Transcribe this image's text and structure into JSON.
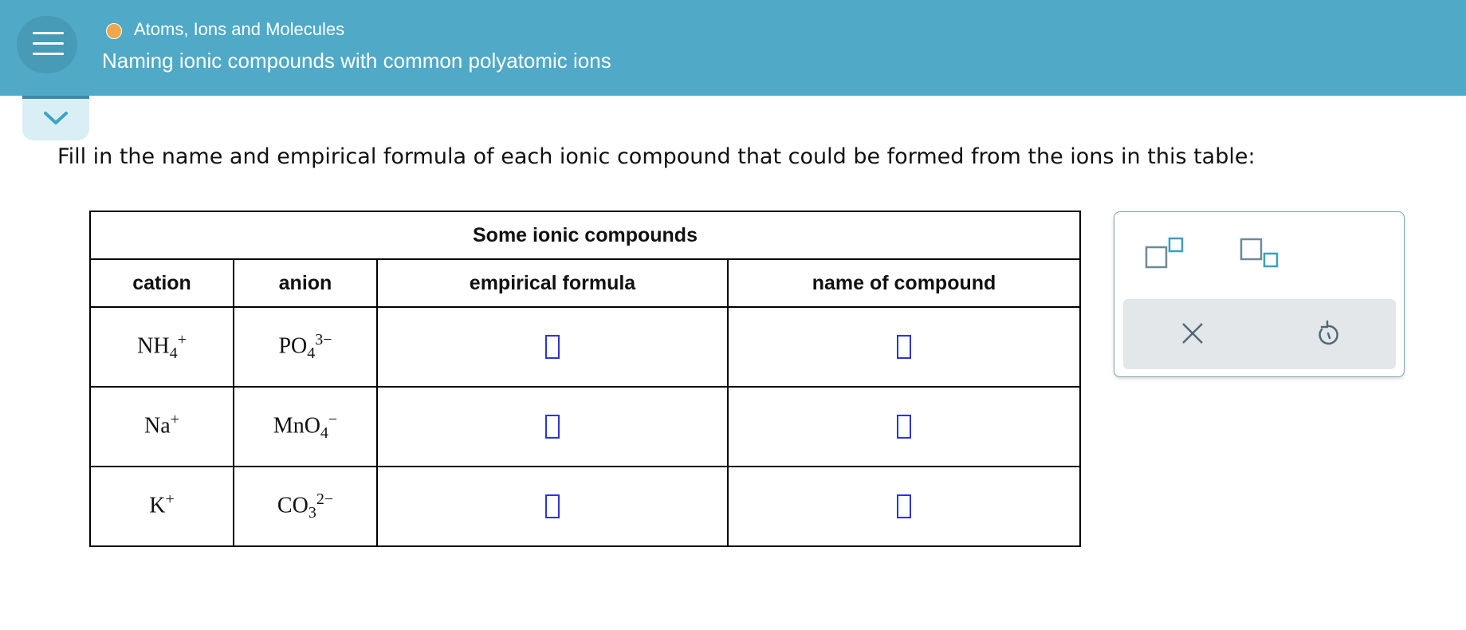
{
  "header": {
    "topic": "Atoms, Ions and Molecules",
    "lesson": "Naming ionic compounds with common polyatomic ions",
    "status_color": "#f0a64b",
    "icons": [
      "menu-icon",
      "chevron-down-icon"
    ]
  },
  "question": {
    "instruction": "Fill in the name and empirical formula of each ionic compound that could be formed from the ions in this table:"
  },
  "table": {
    "caption": "Some ionic compounds",
    "headers": {
      "cation": "cation",
      "anion": "anion",
      "formula": "empirical formula",
      "name": "name of compound"
    },
    "rows": [
      {
        "cation": {
          "base": "NH",
          "sub": "4",
          "sup": "+"
        },
        "anion": {
          "base": "PO",
          "sub": "4",
          "sup": "3−"
        },
        "formula": "",
        "name": ""
      },
      {
        "cation": {
          "base": "Na",
          "sub": "",
          "sup": "+"
        },
        "anion": {
          "base": "MnO",
          "sub": "4",
          "sup": "−"
        },
        "formula": "",
        "name": ""
      },
      {
        "cation": {
          "base": "K",
          "sub": "",
          "sup": "+"
        },
        "anion": {
          "base": "CO",
          "sub": "3",
          "sup": "2−"
        },
        "formula": "",
        "name": ""
      }
    ]
  },
  "tools": {
    "superscript_icon": "superscript-template-icon",
    "subscript_icon": "subscript-template-icon",
    "clear_icon": "close-icon",
    "undo_icon": "undo-icon",
    "accent_color": "#4fa9c7",
    "input_color": "#2b35d6"
  }
}
